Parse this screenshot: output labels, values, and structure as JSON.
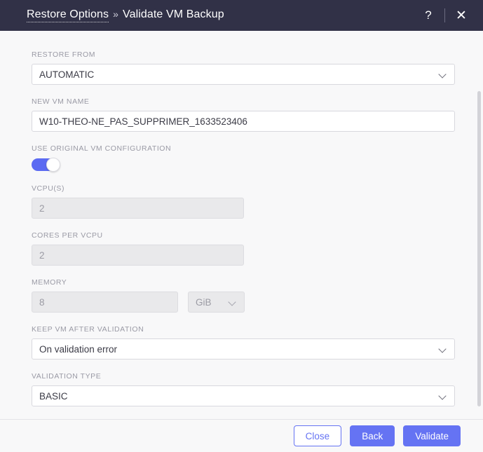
{
  "header": {
    "breadcrumb_link": "Restore Options",
    "breadcrumb_separator": "»",
    "breadcrumb_current": "Validate VM Backup",
    "help_icon": "?",
    "close_icon": "✕"
  },
  "colors": {
    "header_bg": "#313147",
    "accent": "#6573f3",
    "toggle_on": "#5b6af2",
    "page_bg": "#f8f8f9",
    "label": "#9a9aa5",
    "input_border": "#d8d8de",
    "disabled_bg": "#e9e9eb"
  },
  "form": {
    "restore_from": {
      "label": "RESTORE FROM",
      "value": "AUTOMATIC",
      "icon": "chevron-down-icon"
    },
    "new_vm_name": {
      "label": "NEW VM NAME",
      "value": "W10-THEO-NE_PAS_SUPPRIMER_1633523406"
    },
    "use_original_vm_configuration": {
      "label": "USE ORIGINAL VM CONFIGURATION",
      "state": "on"
    },
    "vcpus": {
      "label": "VCPU(S)",
      "value": "2",
      "disabled": true
    },
    "cores_per_vcpu": {
      "label": "CORES PER VCPU",
      "value": "2",
      "disabled": true
    },
    "memory": {
      "label": "MEMORY",
      "value": "8",
      "unit": "GiB",
      "disabled": true
    },
    "keep_vm_after_validation": {
      "label": "KEEP VM AFTER VALIDATION",
      "value": "On validation error"
    },
    "validation_type": {
      "label": "VALIDATION TYPE",
      "value": "BASIC"
    }
  },
  "footer": {
    "close_label": "Close",
    "back_label": "Back",
    "validate_label": "Validate"
  }
}
